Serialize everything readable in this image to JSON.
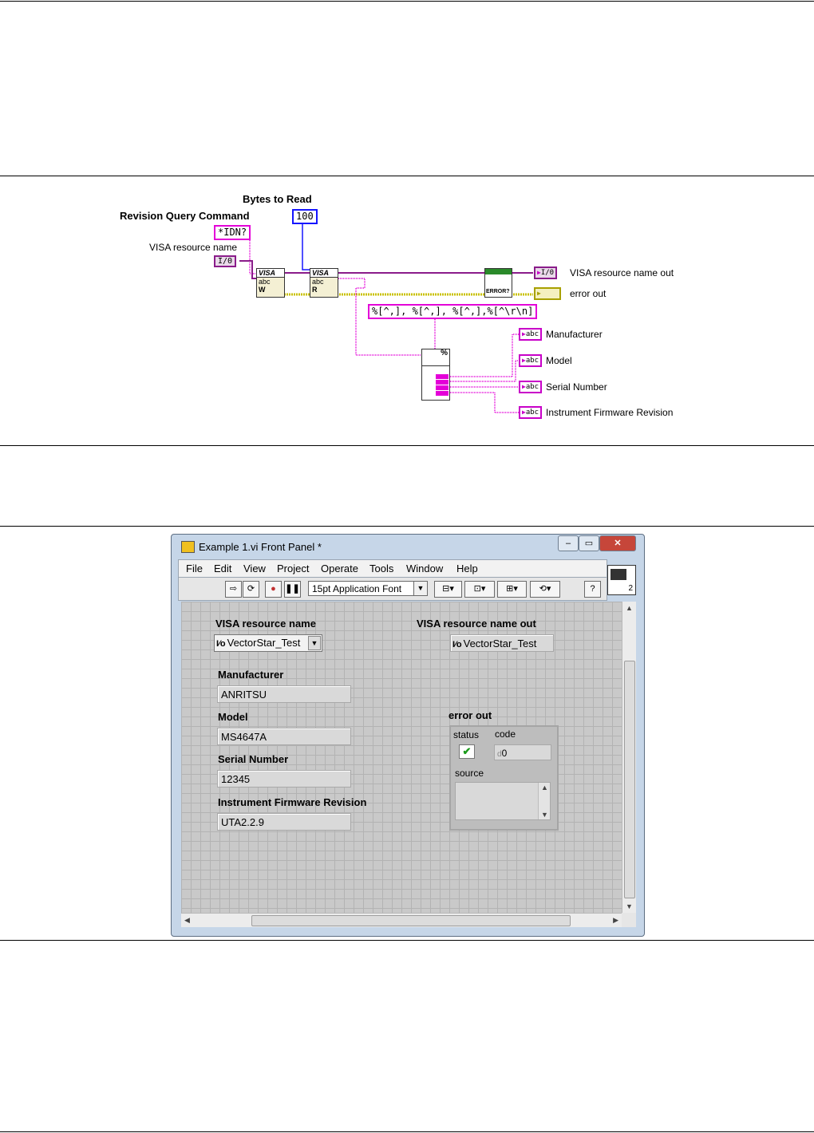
{
  "block_diagram": {
    "bytes_to_read_label": "Bytes to Read",
    "bytes_to_read_value": "100",
    "revision_query_label": "Revision Query Command",
    "revision_query_value": "*IDN?",
    "visa_resource_label": "VISA resource name",
    "io_tag": "I/0",
    "visa_node_text": "VISA",
    "abc_text": "abc",
    "write_letter": "W",
    "read_letter": "R",
    "error_node_text": "ERROR?",
    "visa_out_label": "VISA resource name out",
    "error_out_label": "error out",
    "format_string": "%[^,], %[^,], %[^,],%[^\\r\\n]",
    "abc_tag": "abc",
    "outputs": [
      "Manufacturer",
      "Model",
      "Serial Number",
      "Instrument Firmware Revision"
    ]
  },
  "window": {
    "title": "Example 1.vi Front Panel *",
    "menu": [
      "File",
      "Edit",
      "View",
      "Project",
      "Operate",
      "Tools",
      "Window",
      "Help"
    ],
    "font_selector": "15pt Application Font",
    "icon_badge": "2",
    "help_glyph": "?",
    "front_panel": {
      "visa_resource_label": "VISA resource name",
      "visa_resource_value": "VectorStar_Test",
      "visa_out_label": "VISA resource name out",
      "visa_out_value": "VectorStar_Test",
      "manufacturer_label": "Manufacturer",
      "manufacturer_value": "ANRITSU",
      "model_label": "Model",
      "model_value": "MS4647A",
      "serial_label": "Serial Number",
      "serial_value": "12345",
      "firmware_label": "Instrument Firmware Revision",
      "firmware_value": "UTA2.2.9",
      "error_out_label": "error out",
      "status_label": "status",
      "code_label": "code",
      "code_value": "0",
      "code_prefix": "d",
      "source_label": "source",
      "status_glyph": "✔"
    }
  },
  "colors": {
    "string_wire": "#e400d8",
    "numeric_wire": "#1515ff",
    "error_wire": "#c8c000",
    "visa_wire": "#8a1c8a"
  }
}
